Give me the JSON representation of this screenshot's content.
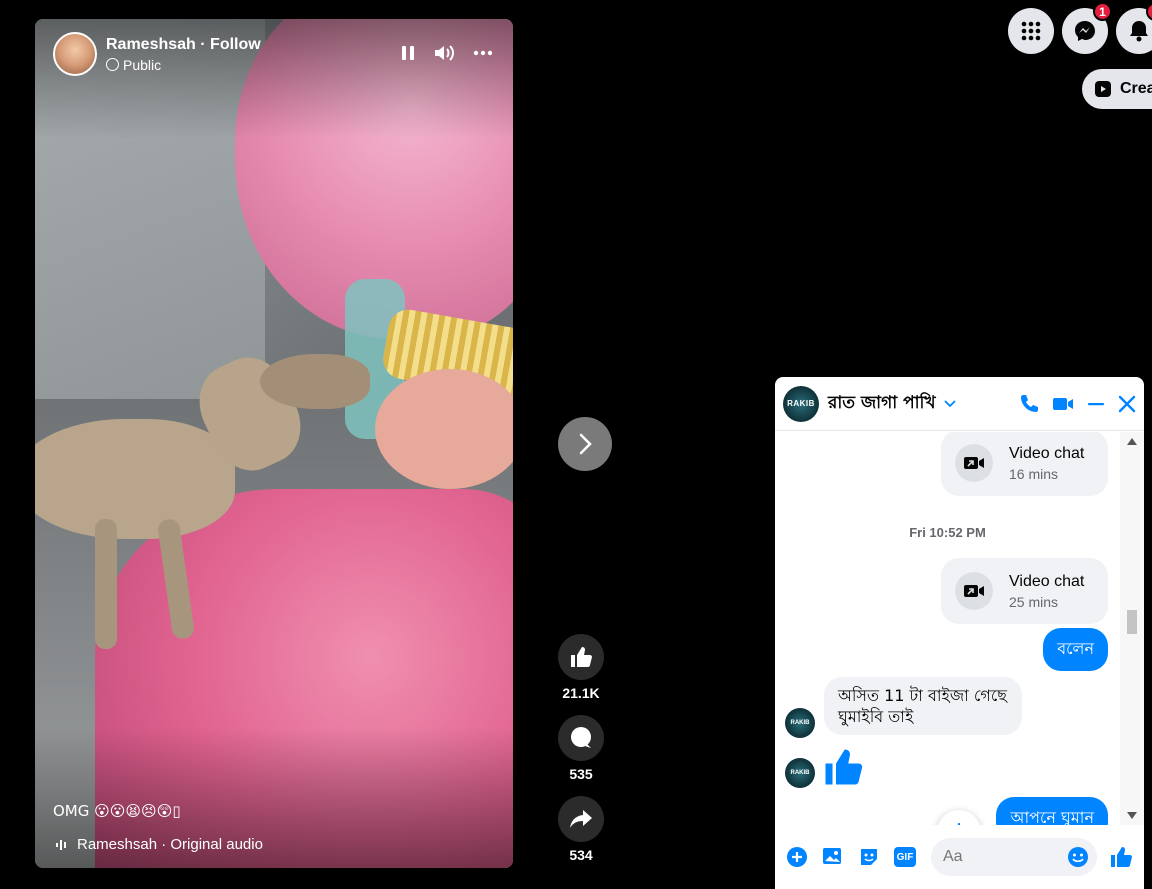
{
  "video": {
    "author": "Rameshsah · Follow",
    "privacy": "Public",
    "caption": "OMG 😮😮😫😣😲▯",
    "audio": "Rameshsah · Original audio"
  },
  "actions": {
    "likes": "21.1K",
    "comments": "535",
    "shares": "534"
  },
  "topbar": {
    "messenger_badge": "1",
    "create_label": "Create"
  },
  "chat": {
    "title": "রাত জাগা পাখি",
    "avatar_text": "RAKIB",
    "messages": {
      "call1_title": "Video chat",
      "call1_sub": "16 mins",
      "timestamp": "Fri 10:52 PM",
      "call2_title": "Video chat",
      "call2_sub": "25 mins",
      "out1": "বলেন",
      "in1": "অসিত 11 টা বাইজা গেছে ঘুমাইবি তাই",
      "out2": "আপনে ঘুমান"
    },
    "input_placeholder": "Aa"
  },
  "colors": {
    "accent": "#0084ff",
    "badge": "#e41e3f"
  }
}
